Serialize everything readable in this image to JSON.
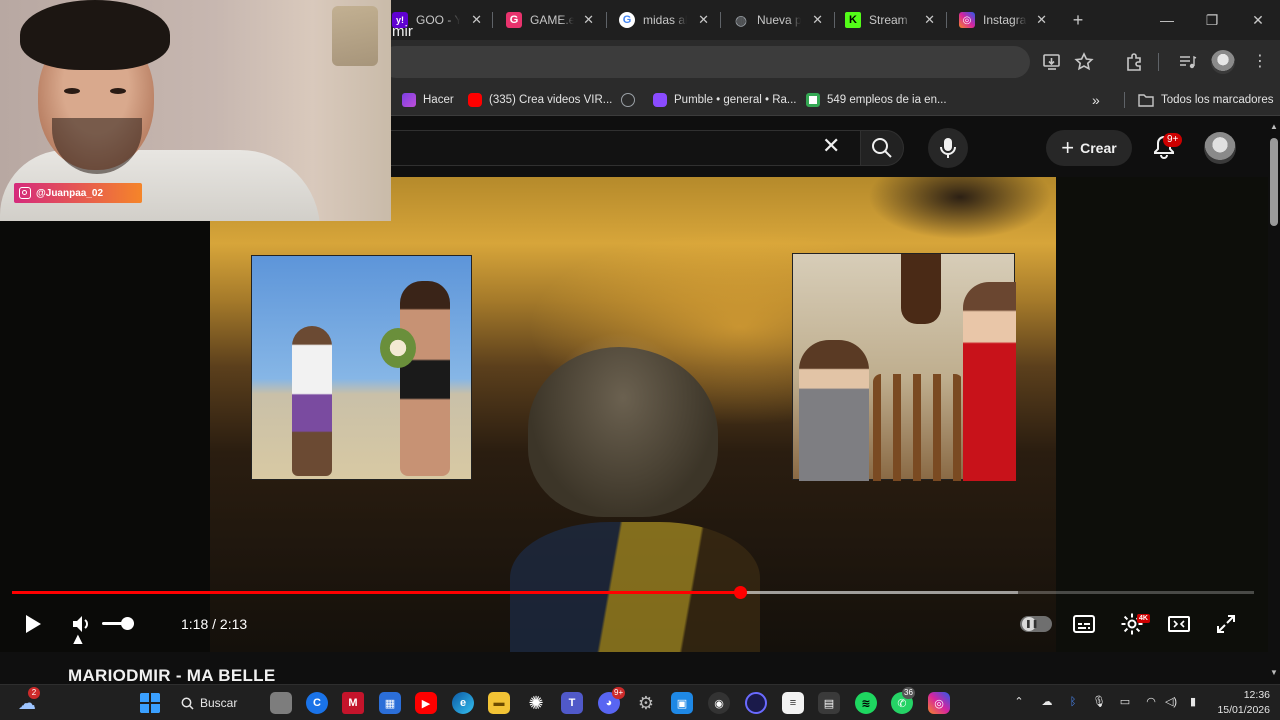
{
  "browser": {
    "tabs": [
      {
        "label": "GOO - Y",
        "favicon": "yahoo-icon",
        "color": "#6001d2",
        "glyph": "y!"
      },
      {
        "label": "GAME.es",
        "favicon": "game-g-icon",
        "color": "#e8336d",
        "glyph": "G"
      },
      {
        "label": "midas al",
        "favicon": "google-icon",
        "color": "#ffffff",
        "glyph": "G"
      },
      {
        "label": "Nueva p",
        "favicon": "globe-icon",
        "color": "#9aa0a6",
        "glyph": "◍"
      },
      {
        "label": "Stream",
        "favicon": "kick-icon",
        "color": "#53fc18",
        "glyph": "K"
      },
      {
        "label": "Instagra",
        "favicon": "instagram-icon",
        "color": "#d6249f",
        "glyph": "◎"
      }
    ],
    "new_tab": "+",
    "window_controls": {
      "minimize": "—",
      "restore": "❐",
      "close": "✕"
    }
  },
  "bookmarks": {
    "items": [
      {
        "label": "Hacer",
        "favicon": "bookmark-hacer-icon",
        "color": "#7b3fe4"
      },
      {
        "label": "(335) Crea videos VIR...",
        "favicon": "youtube-icon",
        "color": "#ff0000"
      },
      {
        "label": "",
        "favicon": "globe-icon",
        "color": "#9aa0a6"
      },
      {
        "label": "Pumble • general • Ra...",
        "favicon": "pumble-icon",
        "color": "#8a4bff"
      },
      {
        "label": "549 empleos de ia en...",
        "favicon": "sheet-icon",
        "color": "#34a853"
      }
    ],
    "more": "»",
    "all_bookmarks": "Todos los marcadores"
  },
  "youtube": {
    "search_value": "mir",
    "create_label": "Crear",
    "notifications_badge": "9+",
    "video_title": "MARIODMIR - MA BELLE"
  },
  "player": {
    "current_time": "1:18",
    "duration": "2:13",
    "time_display": "1:18 / 2:13",
    "progress_fraction": 0.586,
    "buffered_fraction": 0.81,
    "volume_fraction": 1.0,
    "quality_badge": "4K",
    "accent": "#ff0000"
  },
  "webcam": {
    "handle": "@Juanpaa_02"
  },
  "taskbar": {
    "search_label": "Buscar",
    "weather_badge": "2",
    "discord_badge": "9+",
    "whatsapp_badge": "36",
    "time": "12:36",
    "date": "15/01/2026"
  }
}
